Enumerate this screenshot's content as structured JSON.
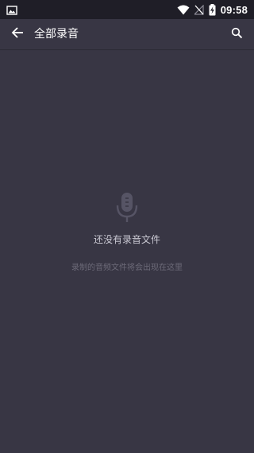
{
  "status_bar": {
    "time": "09:58",
    "icons": [
      "image-icon",
      "wifi-icon",
      "no-signal-icon",
      "battery-charging-icon"
    ]
  },
  "app_bar": {
    "title": "全部录音",
    "back_icon": "arrow-back-icon",
    "search_icon": "search-icon"
  },
  "empty_state": {
    "icon": "microphone-icon",
    "title": "还没有录音文件",
    "subtitle": "录制的音频文件将会出现在这里"
  },
  "colors": {
    "background": "#383644",
    "status_bar": "#1f1e27",
    "title_text": "#ffffff",
    "empty_title": "#c9c8d2",
    "empty_subtitle": "#6c6a78"
  }
}
